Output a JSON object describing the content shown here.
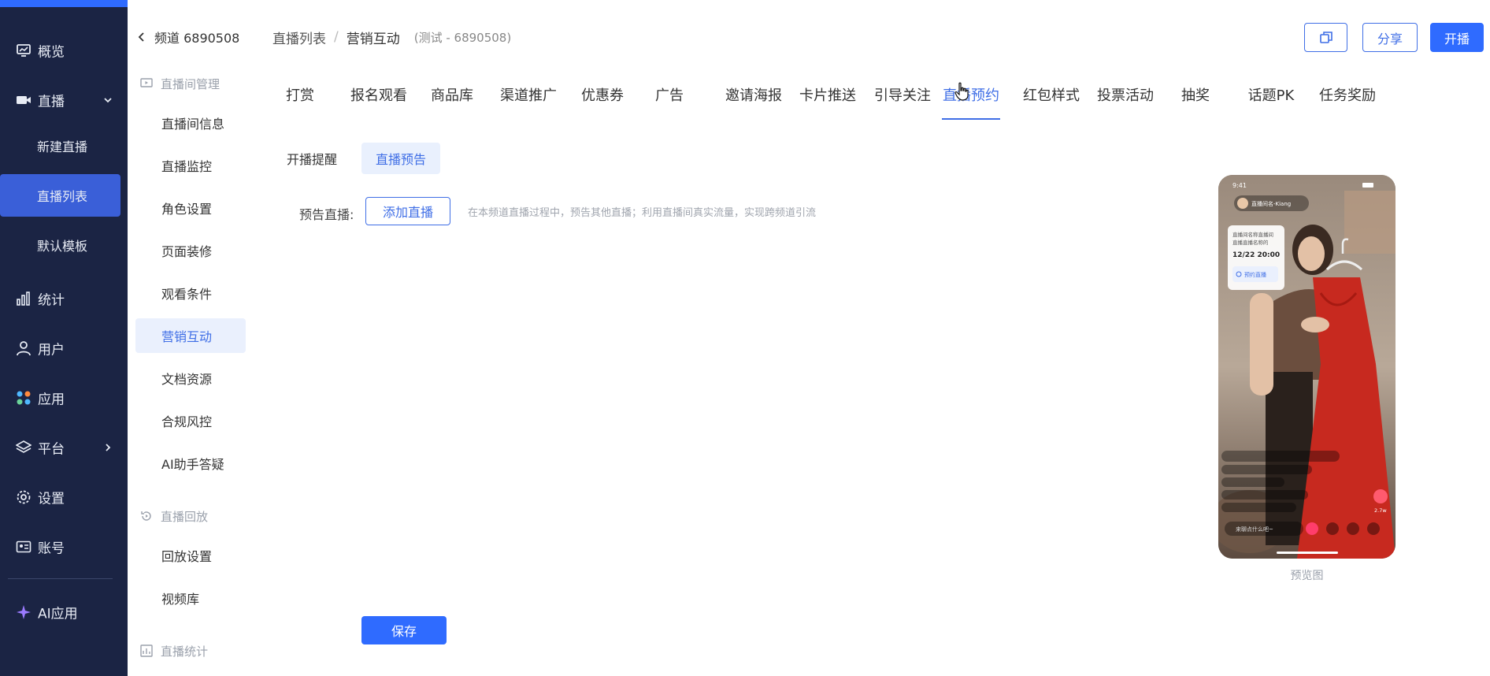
{
  "nav": {
    "items": [
      {
        "label": "概览",
        "icon": "dashboard-icon"
      },
      {
        "label": "直播",
        "icon": "video-icon"
      },
      {
        "label": "统计",
        "icon": "bar-chart-icon"
      },
      {
        "label": "用户",
        "icon": "user-icon"
      },
      {
        "label": "应用",
        "icon": "apps-icon"
      },
      {
        "label": "平台",
        "icon": "layers-icon"
      },
      {
        "label": "设置",
        "icon": "gear-icon"
      },
      {
        "label": "账号",
        "icon": "id-card-icon"
      },
      {
        "label": "AI应用",
        "icon": "sparkle-icon"
      }
    ],
    "live_sub": [
      "新建直播",
      "直播列表",
      "默认模板"
    ],
    "accent": "#2f6bff",
    "bg": "#1b2444"
  },
  "side": {
    "back_label": "频道 6890508",
    "group_room": "直播间管理",
    "room_items": [
      "直播间信息",
      "直播监控",
      "角色设置",
      "页面装修",
      "观看条件",
      "营销互动",
      "文档资源",
      "合规风控",
      "AI助手答疑"
    ],
    "group_replay": "直播回放",
    "replay_items": [
      "回放设置",
      "视频库"
    ],
    "group_stats": "直播统计"
  },
  "header": {
    "crumb_1": "直播列表",
    "crumb_sep": "/",
    "crumb_2": "营销互动",
    "crumb_3": "(测试 - 6890508)",
    "share_label": "分享",
    "start_label": "开播"
  },
  "tabs": [
    "打赏",
    "报名观看",
    "商品库",
    "渠道推广",
    "优惠券",
    "广告",
    "邀请海报",
    "卡片推送",
    "引导关注",
    "直播预约",
    "红包样式",
    "投票活动",
    "抽奖",
    "话题PK",
    "任务奖励"
  ],
  "subtabs": [
    "开播提醒",
    "直播预告"
  ],
  "form": {
    "label": "预告直播:",
    "add_label": "添加直播",
    "hint": "在本频道直播过程中，预告其他直播；利用直播间真实流量，实现跨频道引流",
    "save_label": "保存"
  },
  "preview": {
    "label": "预览图",
    "time": "9:41",
    "host": "直播间名-Kiang",
    "notice_line1": "直播间名称直播间",
    "notice_line2": "直播直播名称的",
    "notice_time": "12/22 20:00",
    "reserve_label": "预约直播",
    "chat_placeholder": "来聊点什么吧~",
    "like_count": "2.7w"
  }
}
